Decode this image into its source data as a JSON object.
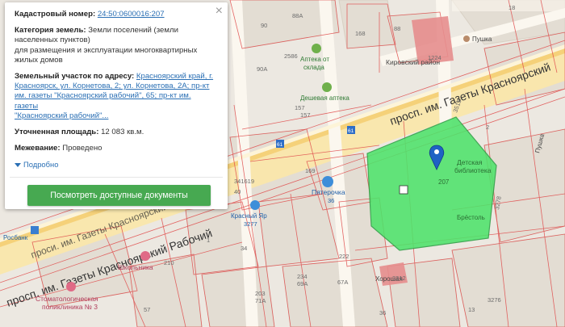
{
  "popup": {
    "cadastral_label": "Кадастровый номер:",
    "cadastral_number": "24:50:0600016:207",
    "category_label": "Категория земель:",
    "category_value_line1": "Земли поселений (земли",
    "category_value_line2": "населенных пунктов)",
    "category_value_line3": "для размещения и эксплуатации многоквартирных",
    "category_value_line4": "жилых домов",
    "address_label": "Земельный участок по адресу:",
    "address_value_line1": "Красноярский край, г.",
    "address_value_line2": "Красноярск, ул. Корнетова, 2; ул. Корнетова, 2А; пр-кт",
    "address_value_line3": "им. газеты \"Красноярский рабочий\", 65; пр-кт им. газеты",
    "address_value_line4": "\"Красноярский рабочий\"...",
    "area_label": "Уточненная площадь:",
    "area_value": "12 083 кв.м.",
    "survey_label": "Межевание:",
    "survey_value": "Проведено",
    "more_label": "Подробно",
    "documents_button": "Посмотреть доступные документы",
    "close_symbol": "×"
  },
  "map": {
    "parcel_color": "#4ee36b",
    "street_main_1": "просп. им. Газеты Красноярский",
    "street_main_2": "просп. им. Газеты Красноярский Рабочий",
    "street_main_3": "проси. им. Газеты Красноярский Рабочий",
    "street_secondary": "Кировский район",
    "parcel_label_1": "Детская",
    "parcel_label_2": "библиотека",
    "parcel_label_3": "207",
    "parcel_label_4": "Брёстоль",
    "poi": [
      {
        "name": "Аптека от",
        "name2": "склада"
      },
      {
        "name": "Дешевая аптека"
      },
      {
        "name": "Пятерочка",
        "sub": "36"
      },
      {
        "name": "Красный Яр",
        "sub": "3277"
      },
      {
        "name": "Пушка"
      },
      {
        "name": "Стоматологическая",
        "sub": "поликлиника № 3"
      },
      {
        "name": "Школьника"
      },
      {
        "name": "Росбанк"
      },
      {
        "name": "Хорошая"
      }
    ],
    "numbers": [
      "168",
      "2586",
      "90А",
      "157",
      "157",
      "341619",
      "40",
      "169",
      "210",
      "234",
      "69А",
      "203",
      "71А",
      "222",
      "67А",
      "3276",
      "3312",
      "1224",
      "18",
      "3278",
      "3513",
      "34",
      "36",
      "88А",
      "88",
      "90",
      "2",
      "1",
      "57",
      "13"
    ],
    "bus_stop_label": "61"
  }
}
